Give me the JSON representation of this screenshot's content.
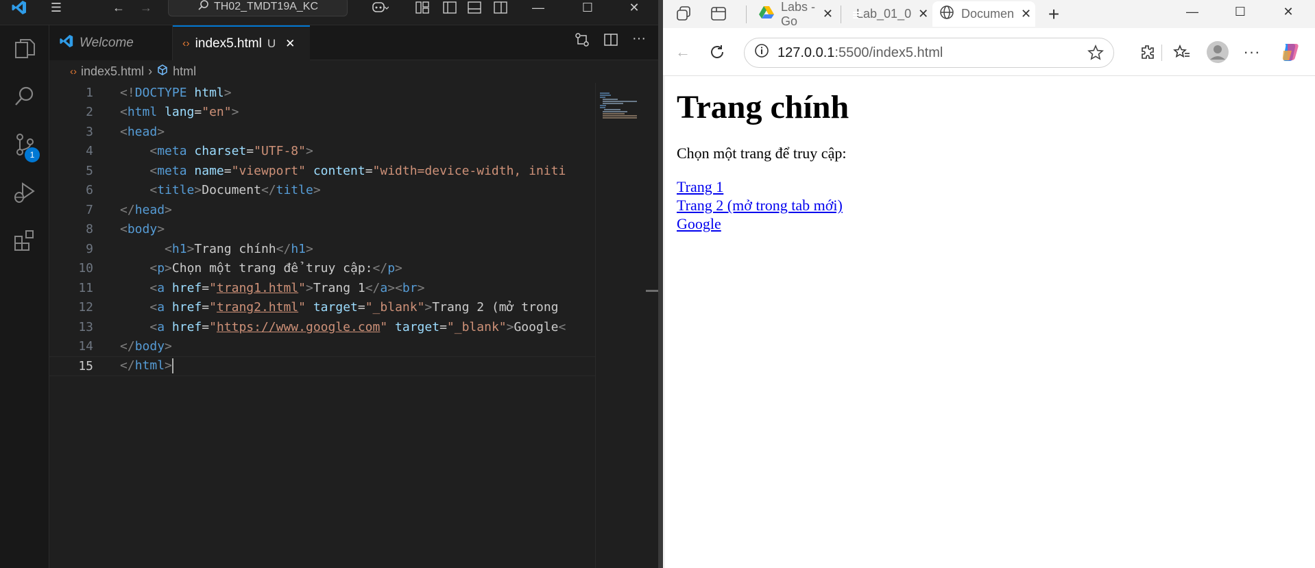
{
  "vscode": {
    "search_text": "TH02_TMDT19A_KC",
    "activity_badge": "1",
    "tabs": [
      {
        "label": "Welcome"
      },
      {
        "label": "index5.html",
        "status": "U",
        "close": "✕"
      }
    ],
    "breadcrumb": {
      "file": "index5.html",
      "node": "html"
    },
    "line_numbers": [
      "1",
      "2",
      "3",
      "4",
      "5",
      "6",
      "7",
      "8",
      "9",
      "10",
      "11",
      "12",
      "13",
      "14",
      "15"
    ]
  },
  "edge": {
    "tabs": [
      {
        "label": "Labs - Go"
      },
      {
        "label": "Lab_01_0"
      },
      {
        "label": "Documen"
      }
    ],
    "address": {
      "host": "127.0.0.1",
      "path": ":5500/index5.html"
    },
    "page": {
      "heading": "Trang chính",
      "intro": "Chọn một trang để truy cập:",
      "links": [
        {
          "text": "Trang 1"
        },
        {
          "text": "Trang 2 (mở trong tab mới)"
        },
        {
          "text": "Google"
        }
      ]
    }
  },
  "colors": {
    "accent": "#0078d4",
    "link": "#0000ee"
  }
}
